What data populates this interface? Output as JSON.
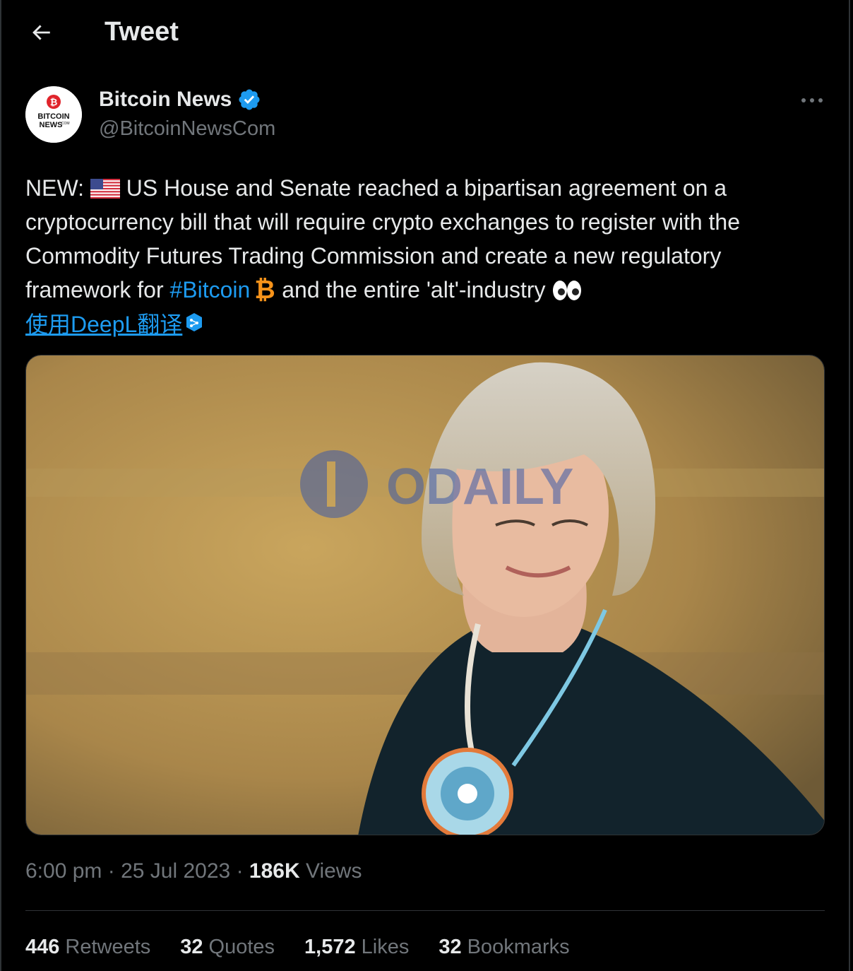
{
  "header": {
    "title": "Tweet"
  },
  "author": {
    "name": "Bitcoin News",
    "handle": "@BitcoinNewsCom",
    "avatar_text_line1": "BITCOIN",
    "avatar_text_line2": "NEWS",
    "avatar_text_sup": ".COM"
  },
  "tweet": {
    "prefix": "NEW: ",
    "text_1": " US House and Senate reached a bipartisan agreement on a cryptocurrency bill that will require crypto exchanges to register with the Commodity Futures Trading Commission and create a new regulatory framework for ",
    "hashtag": "#Bitcoin",
    "text_2": " and the entire 'alt'-industry ",
    "translate_label": "使用DeepL翻译 "
  },
  "media": {
    "watermark": "ODAILY"
  },
  "meta": {
    "time": "6:00 pm",
    "date": "25 Jul 2023",
    "views_count": "186K",
    "views_label": "Views",
    "sep": "·"
  },
  "stats": [
    {
      "count": "446",
      "label": "Retweets"
    },
    {
      "count": "32",
      "label": "Quotes"
    },
    {
      "count": "1,572",
      "label": "Likes"
    },
    {
      "count": "32",
      "label": "Bookmarks"
    }
  ],
  "colors": {
    "accent": "#1d9bf0",
    "muted": "#71767b",
    "text": "#e7e9ea",
    "bitcoin": "#f7931a"
  },
  "icons": [
    "back-arrow-icon",
    "verified-badge-icon",
    "more-options-icon",
    "us-flag-icon",
    "bitcoin-icon",
    "eyes-icon",
    "deepl-icon"
  ]
}
